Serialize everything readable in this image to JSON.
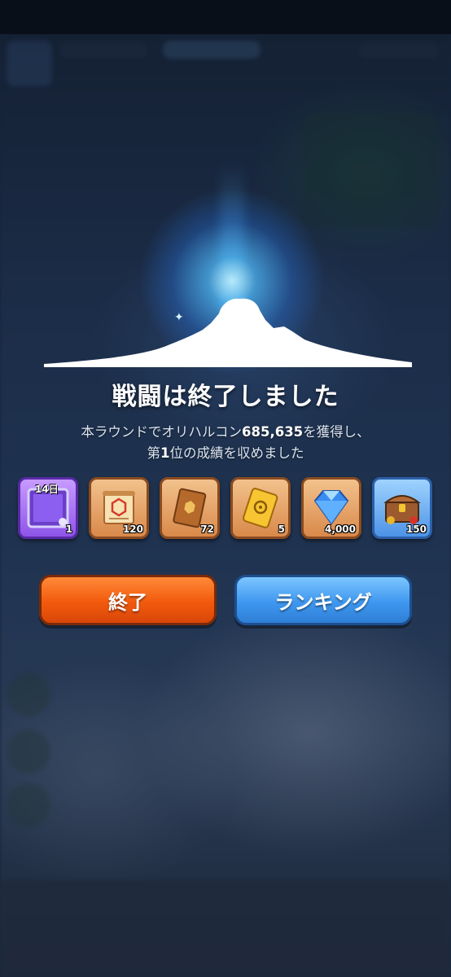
{
  "result": {
    "title": "戦闘は終了しました",
    "line1_pre": "本ラウンドでオリハルコン",
    "orichalcum": "685,635",
    "line1_post": "を獲得し、",
    "line2_pre": "第",
    "rank": "1",
    "line2_post": "位の成績を収めました"
  },
  "rewards": [
    {
      "icon": "avatar-frame-icon",
      "duration": "14日",
      "qty": "1"
    },
    {
      "icon": "scroll-icon",
      "qty": "120"
    },
    {
      "icon": "book-icon",
      "qty": "72"
    },
    {
      "icon": "golden-ticket-icon",
      "qty": "5"
    },
    {
      "icon": "diamond-icon",
      "qty": "4,000"
    },
    {
      "icon": "treasure-chest-icon",
      "qty": "150"
    }
  ],
  "buttons": {
    "end": "終了",
    "ranking": "ランキング"
  },
  "colors": {
    "end_button": "#f25a0c",
    "ranking_button": "#3f97ef",
    "glow": "#5ec2ff"
  }
}
